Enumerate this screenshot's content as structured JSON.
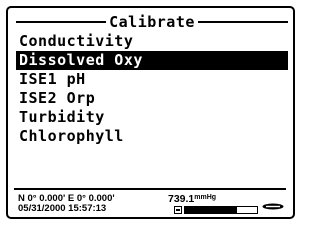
{
  "title": "Calibrate",
  "menu": {
    "items": [
      {
        "label": "Conductivity",
        "selected": false
      },
      {
        "label": "Dissolved Oxy",
        "selected": true
      },
      {
        "label": "ISE1 pH",
        "selected": false
      },
      {
        "label": "ISE2 Orp",
        "selected": false
      },
      {
        "label": "Turbidity",
        "selected": false
      },
      {
        "label": "Chlorophyll",
        "selected": false
      }
    ]
  },
  "status": {
    "gps": "N 0° 0.000' E 0° 0.000'",
    "datetime": "05/31/2000 15:57:13",
    "pressure_value": "739.1",
    "pressure_unit": "mmHg",
    "progress_fraction": 0.72,
    "battery_icon": "battery-icon",
    "brand_icon": "brand-logo-icon"
  }
}
